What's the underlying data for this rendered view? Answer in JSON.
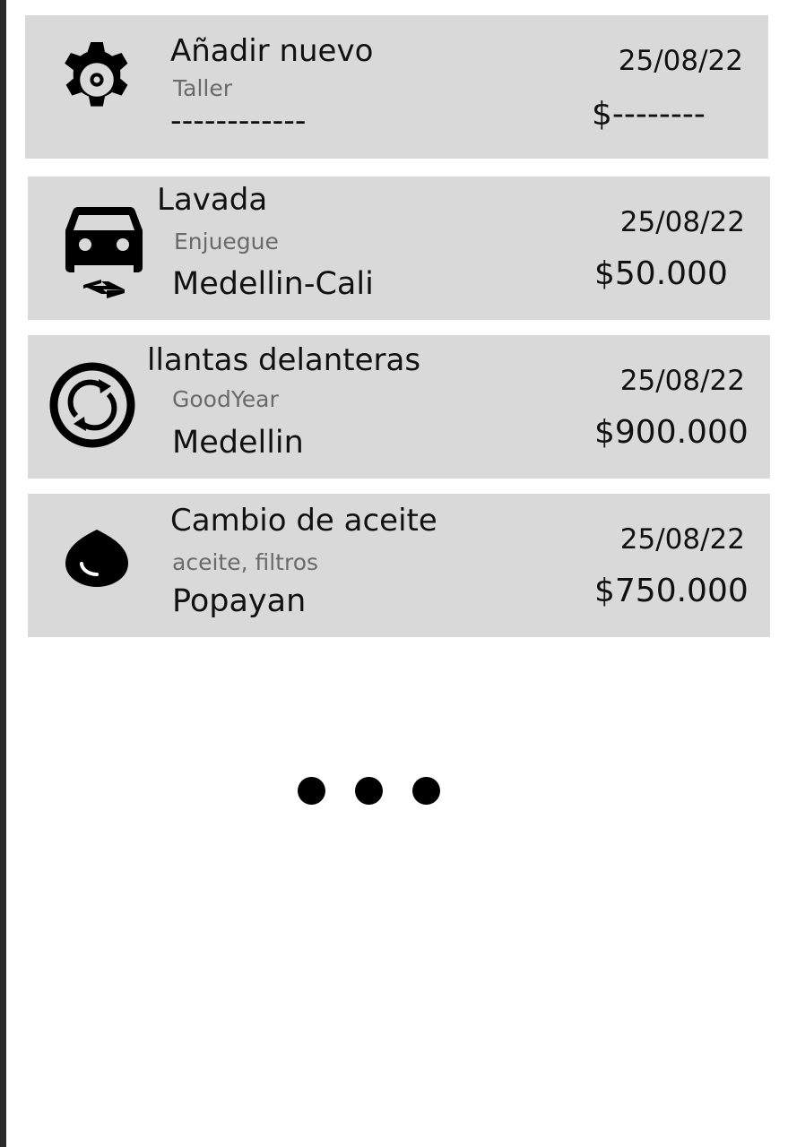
{
  "entries": [
    {
      "icon": "gear-icon",
      "title": "Añadir nuevo",
      "subtitle": "Taller",
      "location": "------------",
      "date": "25/08/22",
      "price": "$--------"
    },
    {
      "icon": "car-wash-icon",
      "title": "Lavada",
      "subtitle": "Enjuegue",
      "location": "Medellin-Cali",
      "date": "25/08/22",
      "price": "$50.000"
    },
    {
      "icon": "sync-icon",
      "title": "llantas delanteras",
      "subtitle": "GoodYear",
      "location": "Medellin",
      "date": "25/08/22",
      "price": "$900.000"
    },
    {
      "icon": "oil-drop-icon",
      "title": "Cambio de aceite",
      "subtitle": "aceite, filtros",
      "location": "Popayan",
      "date": "25/08/22",
      "price": "$750.000"
    }
  ],
  "colors": {
    "card_background": "#d9d9d9",
    "secondary_text": "#6a6a6a",
    "primary_text": "#111111",
    "left_border": "#2b2b2b"
  }
}
